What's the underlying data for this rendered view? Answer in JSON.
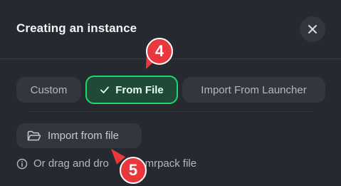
{
  "dialog": {
    "title": "Creating an instance"
  },
  "tabs": [
    {
      "label": "Custom",
      "selected": false
    },
    {
      "label": "From File",
      "selected": true
    },
    {
      "label": "Import From Launcher",
      "selected": false
    }
  ],
  "import_button": {
    "label": "Import from file",
    "icon": "folder-open-icon"
  },
  "hint": {
    "icon": "info-icon",
    "text_before": "Or drag and dro",
    "text_after": "ur .mrpack file"
  },
  "annotations": {
    "marker_4": "4",
    "marker_5": "5"
  },
  "colors": {
    "background": "#26292f",
    "tab_background": "#33363d",
    "selected_border": "#1bd96a",
    "selected_background": "#1f4a37",
    "marker": "#e8383d"
  }
}
